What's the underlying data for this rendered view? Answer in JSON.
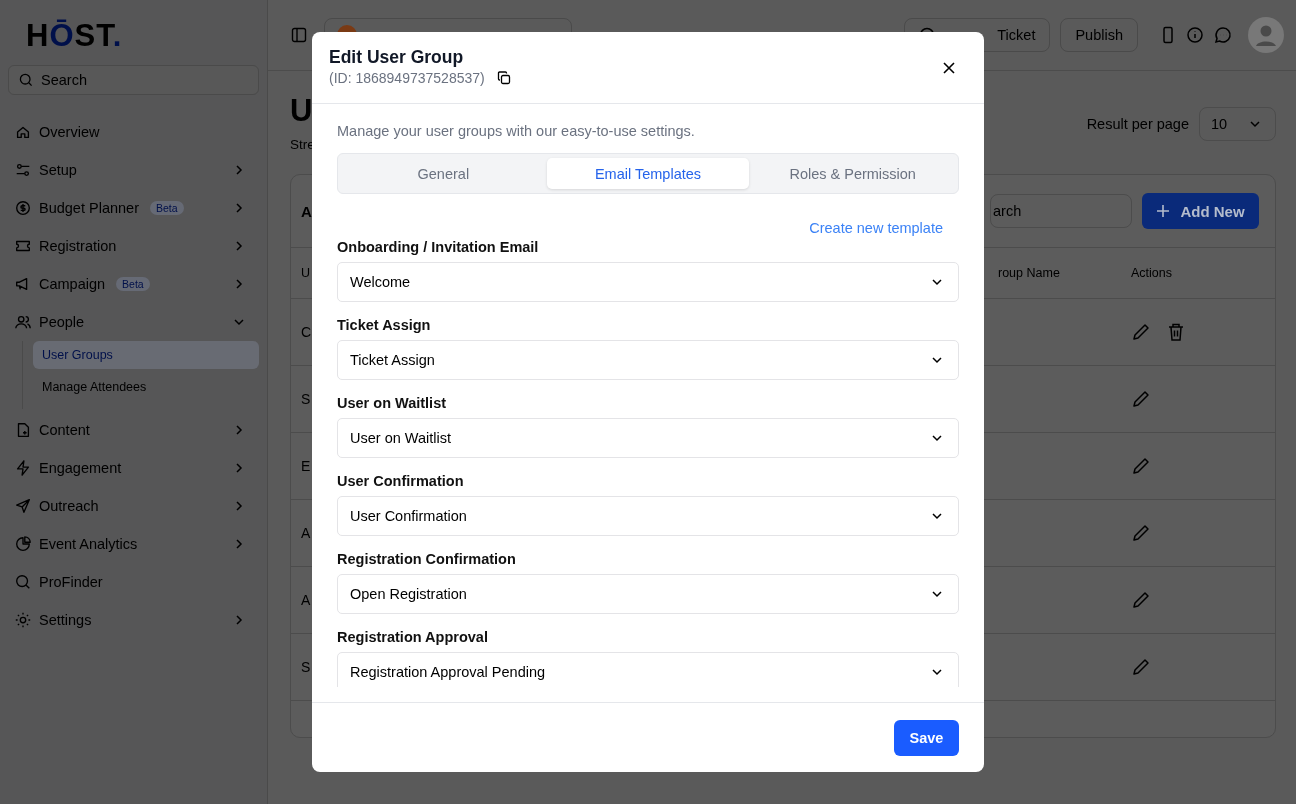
{
  "logo": [
    {
      "text": "H",
      "accent": false
    },
    {
      "text": "Ō",
      "accent": true
    },
    {
      "text": "ST",
      "accent": false
    },
    {
      "text": ".",
      "accent": true
    }
  ],
  "sidebar": {
    "search_placeholder": "Search",
    "items": [
      {
        "label": "Overview",
        "kind": "link"
      },
      {
        "label": "Setup",
        "kind": "group",
        "expanded": false
      },
      {
        "label": "Budget Planner",
        "kind": "group",
        "expanded": false,
        "badge": "Beta"
      },
      {
        "label": "Registration",
        "kind": "group",
        "expanded": false
      },
      {
        "label": "Campaign",
        "kind": "group",
        "expanded": false,
        "badge": "Beta"
      },
      {
        "label": "People",
        "kind": "group",
        "expanded": true,
        "children": [
          {
            "label": "User Groups",
            "selected": true
          },
          {
            "label": "Manage Attendees",
            "selected": false
          }
        ]
      },
      {
        "label": "Content",
        "kind": "group",
        "expanded": false
      },
      {
        "label": "Engagement",
        "kind": "group",
        "expanded": false
      },
      {
        "label": "Outreach",
        "kind": "group",
        "expanded": false
      },
      {
        "label": "Event Analytics",
        "kind": "group",
        "expanded": false
      },
      {
        "label": "ProFinder",
        "kind": "link"
      },
      {
        "label": "Settings",
        "kind": "group",
        "expanded": false
      }
    ]
  },
  "topbar": {
    "ticket_button": "Ticket",
    "publish_button": "Publish"
  },
  "page": {
    "title": "U",
    "subtitle": "Stre",
    "result_label": "Result per page",
    "result_value": "10"
  },
  "card": {
    "title": "A",
    "search_placeholder": "arch",
    "add_button": "Add New",
    "columns": [
      "U",
      "roup Name",
      "Actions"
    ],
    "rows": [
      {
        "cell": "C",
        "deletable": true
      },
      {
        "cell": "S",
        "deletable": false
      },
      {
        "cell": "E",
        "deletable": false
      },
      {
        "cell": "A",
        "deletable": false
      },
      {
        "cell": "A",
        "deletable": false
      },
      {
        "cell": "S",
        "deletable": false
      }
    ]
  },
  "modal": {
    "title": "Edit User Group",
    "id": "(ID: 1868949737528537)",
    "description": "Manage your user groups with our easy-to-use settings.",
    "tabs": [
      {
        "label": "General",
        "selected": false
      },
      {
        "label": "Email Templates",
        "selected": true
      },
      {
        "label": "Roles & Permission",
        "selected": false
      }
    ],
    "create_link": "Create new template",
    "fields": [
      {
        "label": "Onboarding / Invitation Email",
        "value": "Welcome"
      },
      {
        "label": "Ticket Assign",
        "value": "Ticket Assign"
      },
      {
        "label": "User on Waitlist",
        "value": "User on Waitlist"
      },
      {
        "label": "User Confirmation",
        "value": "User Confirmation"
      },
      {
        "label": "Registration Confirmation",
        "value": "Open Registration"
      },
      {
        "label": "Registration Approval",
        "value": "Registration Approval Pending"
      }
    ],
    "save_button": "Save"
  }
}
